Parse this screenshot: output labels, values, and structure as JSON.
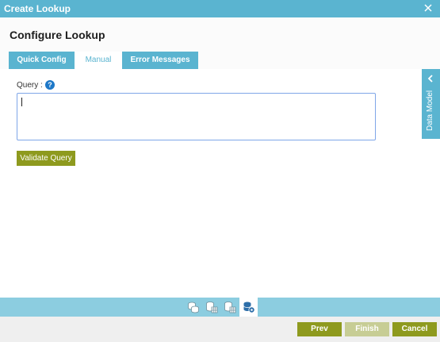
{
  "window": {
    "title": "Create Lookup",
    "close_icon": "close-icon"
  },
  "page": {
    "title": "Configure Lookup"
  },
  "tabs": [
    {
      "label": "Quick Config",
      "active": false
    },
    {
      "label": "Manual",
      "active": true
    },
    {
      "label": "Error Messages",
      "active": false
    }
  ],
  "query": {
    "label": "Query :",
    "help": "?",
    "value": ""
  },
  "validate_button": "Validate Query",
  "data_model": {
    "label": "Data Model",
    "icon": "chevron-left-icon"
  },
  "steps": [
    {
      "icon": "database-icon",
      "active": false
    },
    {
      "icon": "database-table-icon",
      "active": false
    },
    {
      "icon": "database-table-icon",
      "active": false
    },
    {
      "icon": "database-settings-icon",
      "active": true
    }
  ],
  "footer": {
    "prev": "Prev",
    "finish": "Finish",
    "cancel": "Cancel"
  },
  "colors": {
    "accent": "#5ab4d0",
    "button": "#8e9a1e",
    "disabled_button": "#c7cd95"
  }
}
